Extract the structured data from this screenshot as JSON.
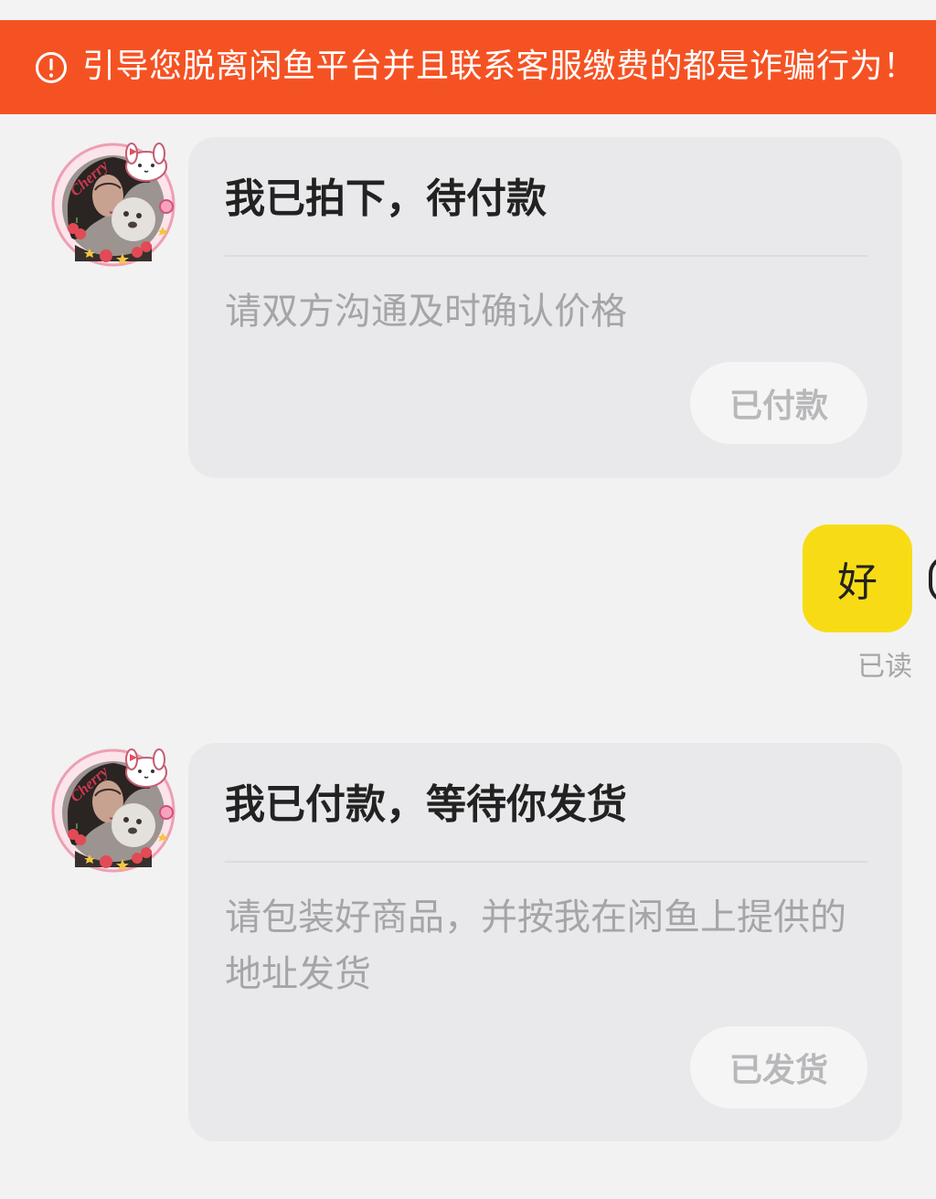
{
  "warning": {
    "text": "引导您脱离闲鱼平台并且联系客服缴费的都是诈骗行为！"
  },
  "messages": [
    {
      "title": "我已拍下，待付款",
      "body": "请双方沟通及时确认价格",
      "button": "已付款"
    },
    {
      "title": "我已付款，等待你发货",
      "body": "请包装好商品，并按我在闲鱼上提供的地址发货",
      "button": "已发货"
    }
  ],
  "avatar": {
    "sticker_text": "Cherry"
  },
  "reply": {
    "text": "好",
    "status": "已读"
  },
  "colors": {
    "banner": "#f55223",
    "my_bubble": "#f7dc15",
    "card": "#e9e9eb",
    "background": "#f2f2f2"
  }
}
